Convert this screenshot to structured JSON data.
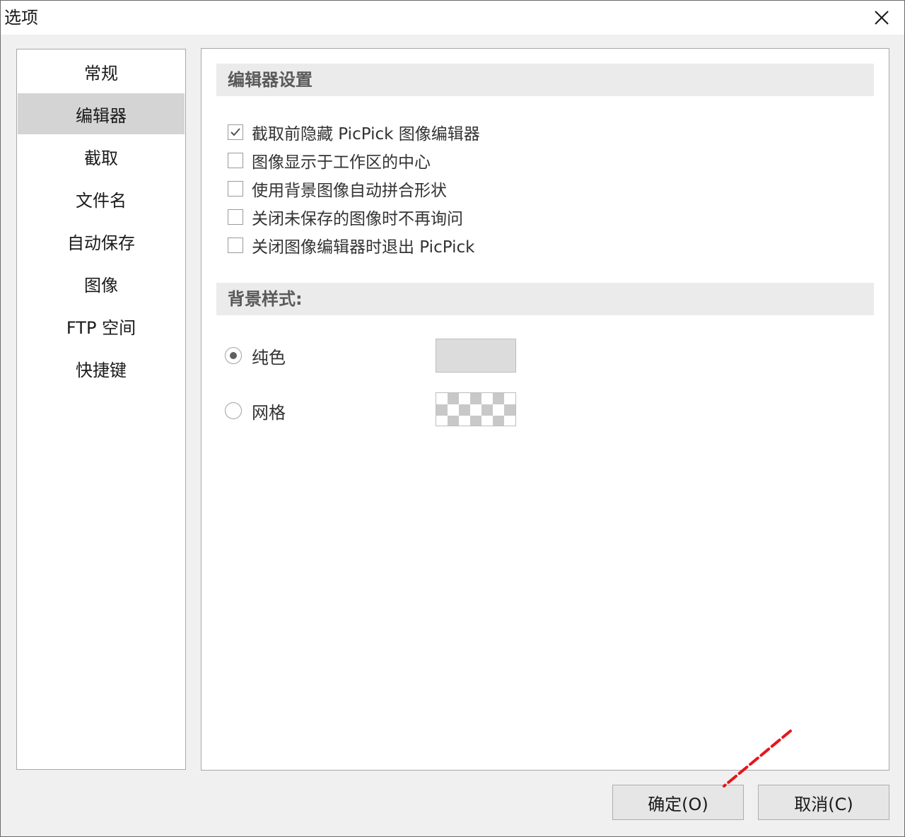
{
  "window": {
    "title": "选项"
  },
  "sidebar": {
    "items": [
      {
        "label": "常规",
        "selected": false
      },
      {
        "label": "编辑器",
        "selected": true
      },
      {
        "label": "截取",
        "selected": false
      },
      {
        "label": "文件名",
        "selected": false
      },
      {
        "label": "自动保存",
        "selected": false
      },
      {
        "label": "图像",
        "selected": false
      },
      {
        "label": "FTP 空间",
        "selected": false
      },
      {
        "label": "快捷键",
        "selected": false
      }
    ]
  },
  "editor_settings": {
    "header": "编辑器设置",
    "options": [
      {
        "label": "截取前隐藏 PicPick 图像编辑器",
        "checked": true
      },
      {
        "label": "图像显示于工作区的中心",
        "checked": false
      },
      {
        "label": "使用背景图像自动拼合形状",
        "checked": false
      },
      {
        "label": "关闭未保存的图像时不再询问",
        "checked": false
      },
      {
        "label": "关闭图像编辑器时退出 PicPick",
        "checked": false
      }
    ]
  },
  "background_style": {
    "header": "背景样式:",
    "options": [
      {
        "label": "纯色",
        "selected": true,
        "swatch": "solid",
        "color": "#dcdcdc"
      },
      {
        "label": "网格",
        "selected": false,
        "swatch": "grid"
      }
    ]
  },
  "buttons": {
    "ok": "确定(O)",
    "cancel": "取消(C)"
  },
  "colors": {
    "selected_nav": "#d4d4d4",
    "section_header_bg": "#ebebeb",
    "annotation": "#e8141c"
  }
}
